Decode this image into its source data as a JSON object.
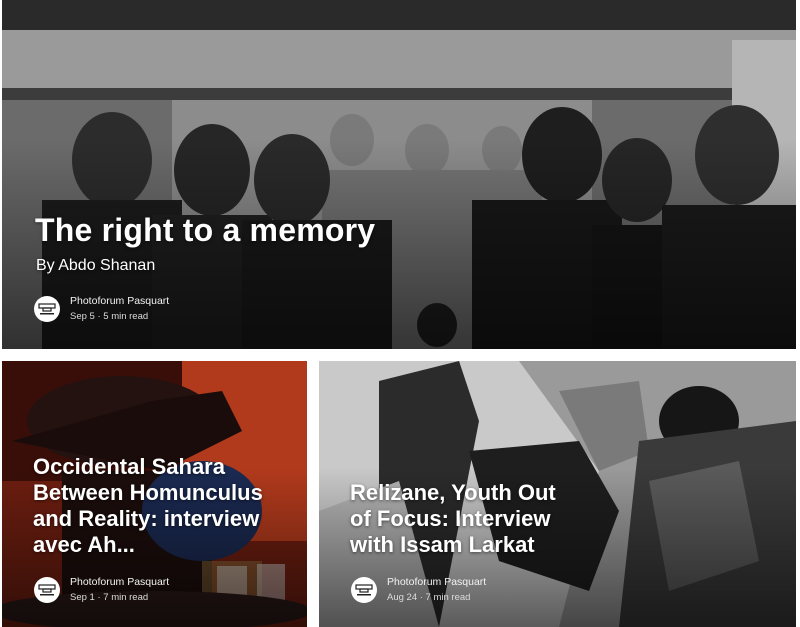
{
  "hero": {
    "title": "The right to a memory",
    "subtitle": "By Abdo Shanan",
    "publication": "Photoforum Pasquart",
    "date_read": "Sep 5 · 5 min read",
    "image_icon": "black-and-white-group-photo"
  },
  "cards": [
    {
      "title": "Occidental Sahara Between Homunculus and Reality: interview avec Ah...",
      "publication": "Photoforum Pasquart",
      "date_read": "Sep 1 · 7 min read",
      "image_icon": "red-interior-tea-photo"
    },
    {
      "title": "Relizane, Youth Out of Focus: Interview with Issam Larkat",
      "publication": "Photoforum Pasquart",
      "date_read": "Aug 24 · 7 min read",
      "image_icon": "black-and-white-flag-fist-photo"
    }
  ],
  "colors": {
    "text": "#ffffff",
    "logo_bg": "#ffffff"
  }
}
